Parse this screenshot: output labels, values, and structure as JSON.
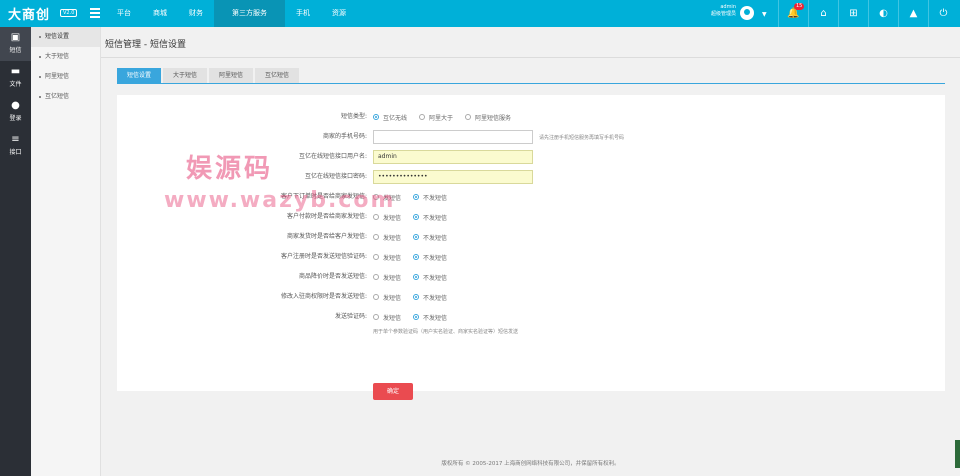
{
  "brand": {
    "logo": "大商创",
    "version": "V2.0"
  },
  "topnav": [
    "平台",
    "商城",
    "财务",
    "第三方服务",
    "手机",
    "资源"
  ],
  "topnav_active": 3,
  "user": {
    "name": "admin",
    "role": "超级管理员"
  },
  "notifications": {
    "count": "15"
  },
  "top_icons": [
    "bell-icon",
    "home-icon",
    "sitemap-icon",
    "palette-icon",
    "user-icon",
    "power-icon"
  ],
  "rail": [
    {
      "label": "短信",
      "icon": "sms-icon"
    },
    {
      "label": "文件",
      "icon": "folder-icon"
    },
    {
      "label": "登录",
      "icon": "users-icon"
    },
    {
      "label": "接口",
      "icon": "sliders-icon"
    }
  ],
  "submenu": [
    "短信设置",
    "大于短信",
    "阿里短信",
    "互亿短信"
  ],
  "page": {
    "title": "短信管理 - 短信设置"
  },
  "tabs": [
    "短信设置",
    "大于短信",
    "阿里短信",
    "互亿短信"
  ],
  "form": {
    "sms_type": {
      "label": "短信类型:",
      "options": [
        "互亿无线",
        "阿里大于",
        "阿里短信服务"
      ],
      "selected": 0
    },
    "merchant_phone": {
      "label": "商家的手机号码:",
      "value": "",
      "hint": "请先注册手机短信服务再填写手机号码"
    },
    "username": {
      "label": "互亿在线短信接口用户名:",
      "value": "admin"
    },
    "password": {
      "label": "互亿在线短信接口密码:",
      "value": "••••••••••••••"
    },
    "toggles": [
      {
        "label": "客户下订单时是否给商家发短信:"
      },
      {
        "label": "客户付款时是否给商家发短信:"
      },
      {
        "label": "商家发货时是否给客户发短信:"
      },
      {
        "label": "客户注册时是否发送短信验证码:"
      },
      {
        "label": "商品降价时是否发送短信:"
      },
      {
        "label": "修改入驻商权限时是否发送短信:"
      },
      {
        "label": "发送验证码:"
      }
    ],
    "toggle_options": [
      "发短信",
      "不发短信"
    ],
    "toggle_selected": 1,
    "note": "用于单个参数验证码（用户实名验证、商家实名验证等）短信发送",
    "submit": "确定"
  },
  "watermark": {
    "line1": "娱源码",
    "line2": "www.wazyb.com"
  },
  "footer": "版权所有 © 2005-2017 上海商创网络科技有限公司，并保留所有权利。"
}
